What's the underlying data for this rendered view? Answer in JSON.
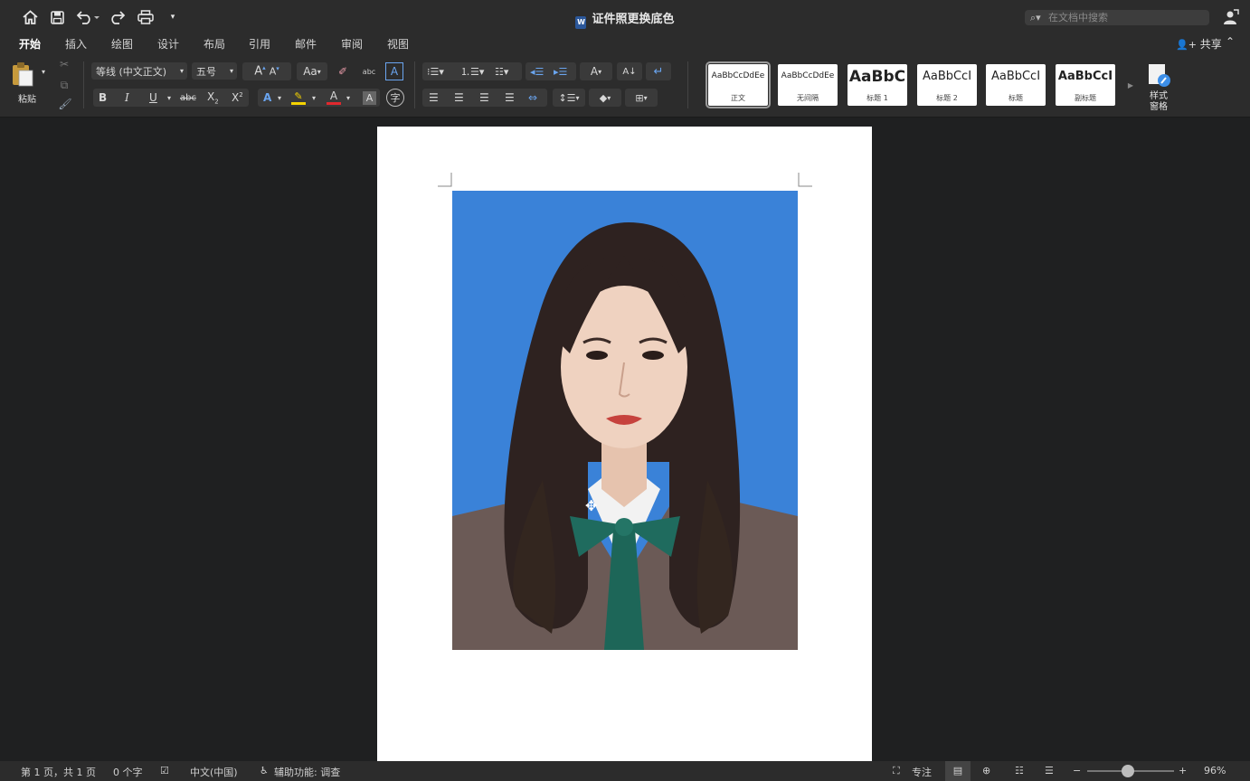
{
  "window": {
    "title": "证件照更换底色"
  },
  "search": {
    "placeholder": "在文档中搜索"
  },
  "tabs": [
    {
      "label": "开始",
      "active": true
    },
    {
      "label": "插入"
    },
    {
      "label": "绘图"
    },
    {
      "label": "设计"
    },
    {
      "label": "布局"
    },
    {
      "label": "引用"
    },
    {
      "label": "邮件"
    },
    {
      "label": "审阅"
    },
    {
      "label": "视图"
    }
  ],
  "share": {
    "label": "共享"
  },
  "ribbon": {
    "paste_label": "粘贴",
    "font_name": "等线 (中文正文)",
    "font_size": "五号",
    "bold": "B",
    "italic": "I",
    "underline": "U",
    "strike": "abc",
    "styles_pane_label": "样式\n窗格",
    "styles": [
      {
        "sample": "AaBbCcDdEe",
        "name": "正文",
        "selected": true
      },
      {
        "sample": "AaBbCcDdEe",
        "name": "无间隔"
      },
      {
        "sample": "AaBbC",
        "name": "标题 1"
      },
      {
        "sample": "AaBbCcI",
        "name": "标题 2"
      },
      {
        "sample": "AaBbCcI",
        "name": "标题"
      },
      {
        "sample": "AaBbCcI",
        "name": "副标题"
      }
    ]
  },
  "status": {
    "page": "第 1 页，共 1 页",
    "words": "0 个字",
    "language": "中文(中国)",
    "accessibility": "辅助功能: 调查",
    "focus": "专注",
    "zoom": "96%"
  },
  "colors": {
    "photo_background": "#3a82d8",
    "chrome": "#2c2c2c",
    "workspace": "#1f2021"
  }
}
